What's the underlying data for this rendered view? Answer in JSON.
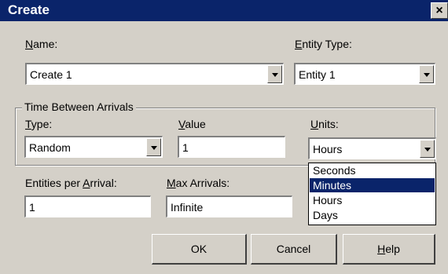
{
  "window": {
    "title": "Create",
    "close_glyph": "×"
  },
  "name_field": {
    "label_key": "N",
    "label_rest": "ame:",
    "value": "Create 1"
  },
  "entity_type": {
    "label_key": "E",
    "label_rest": "ntity Type:",
    "value": "Entity 1"
  },
  "time_between_arrivals": {
    "group_label": "Time Between Arrivals",
    "type": {
      "label_key": "T",
      "label_rest": "ype:",
      "value": "Random"
    },
    "value": {
      "label_key": "V",
      "label_rest": "alue",
      "value": "1"
    },
    "units": {
      "label_key": "U",
      "label_rest": "nits:",
      "value": "Hours",
      "options": [
        "Seconds",
        "Minutes",
        "Hours",
        "Days"
      ],
      "highlighted": "Minutes"
    }
  },
  "entities_per_arrival": {
    "label_pre": "Entities per ",
    "label_key": "A",
    "label_rest": "rrival:",
    "value": "1"
  },
  "max_arrivals": {
    "label_key": "M",
    "label_rest": "ax Arrivals:",
    "value": "Infinite"
  },
  "buttons": {
    "ok": "OK",
    "cancel": "Cancel",
    "help_key": "H",
    "help_rest": "elp"
  },
  "colors": {
    "titlebar": "#0a246a",
    "dialog": "#d4d0c8",
    "selection": "#0a246a"
  }
}
